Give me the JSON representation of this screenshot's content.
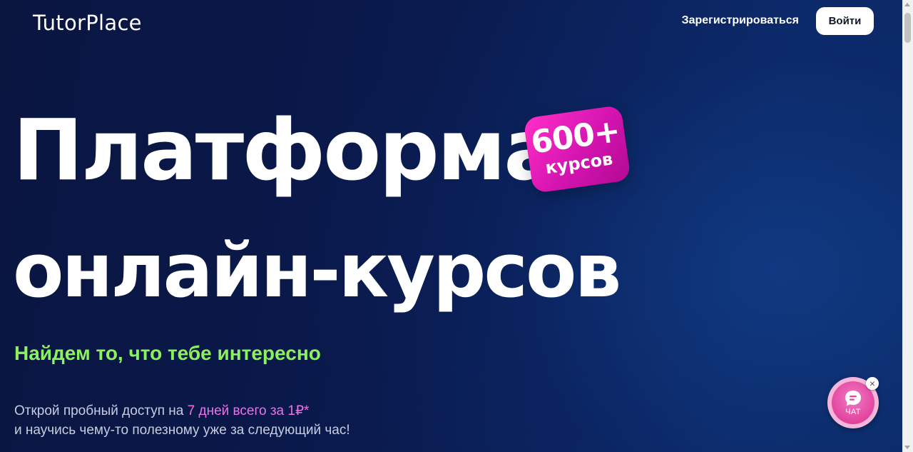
{
  "header": {
    "logo_text": "TutorPlace",
    "register_label": "Зарегистрироваться",
    "login_label": "Войти"
  },
  "hero": {
    "title_line_1": "Платформа",
    "title_line_2": "онлайн-курсов",
    "badge_number": "600+",
    "badge_caption": "курсов",
    "tagline": "Найдем то, что тебе интересно",
    "offer_prefix": "Открой пробный доступ на ",
    "offer_accent": "7 дней всего за 1₽*",
    "offer_line_2": "и научись чему-то полезному уже за следующий час!"
  },
  "chat_widget": {
    "label": "ЧАТ",
    "icon": "chat-bubble-icon",
    "close_icon": "close-icon",
    "close_glyph": "×"
  },
  "colors": {
    "background_dark": "#0a1540",
    "background_light": "#0c2a68",
    "tagline_green": "#8af25f",
    "offer_accent_pink": "#ef6fe7",
    "badge_magenta": "#d414b0",
    "chat_pink": "#e3449e"
  }
}
